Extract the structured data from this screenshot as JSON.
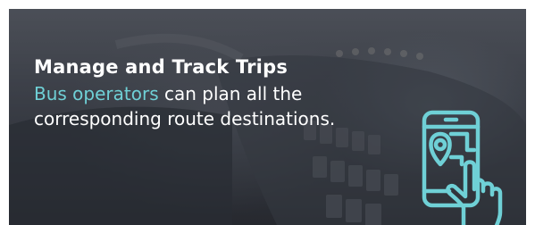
{
  "banner": {
    "headline": "Manage and Track Trips",
    "description_highlight": "Bus operators",
    "description_rest": " can plan all the corresponding route destinations.",
    "icon": "phone-map-pin-hand-icon",
    "colors": {
      "accent": "#6fd0d6",
      "text": "#ffffff"
    }
  }
}
